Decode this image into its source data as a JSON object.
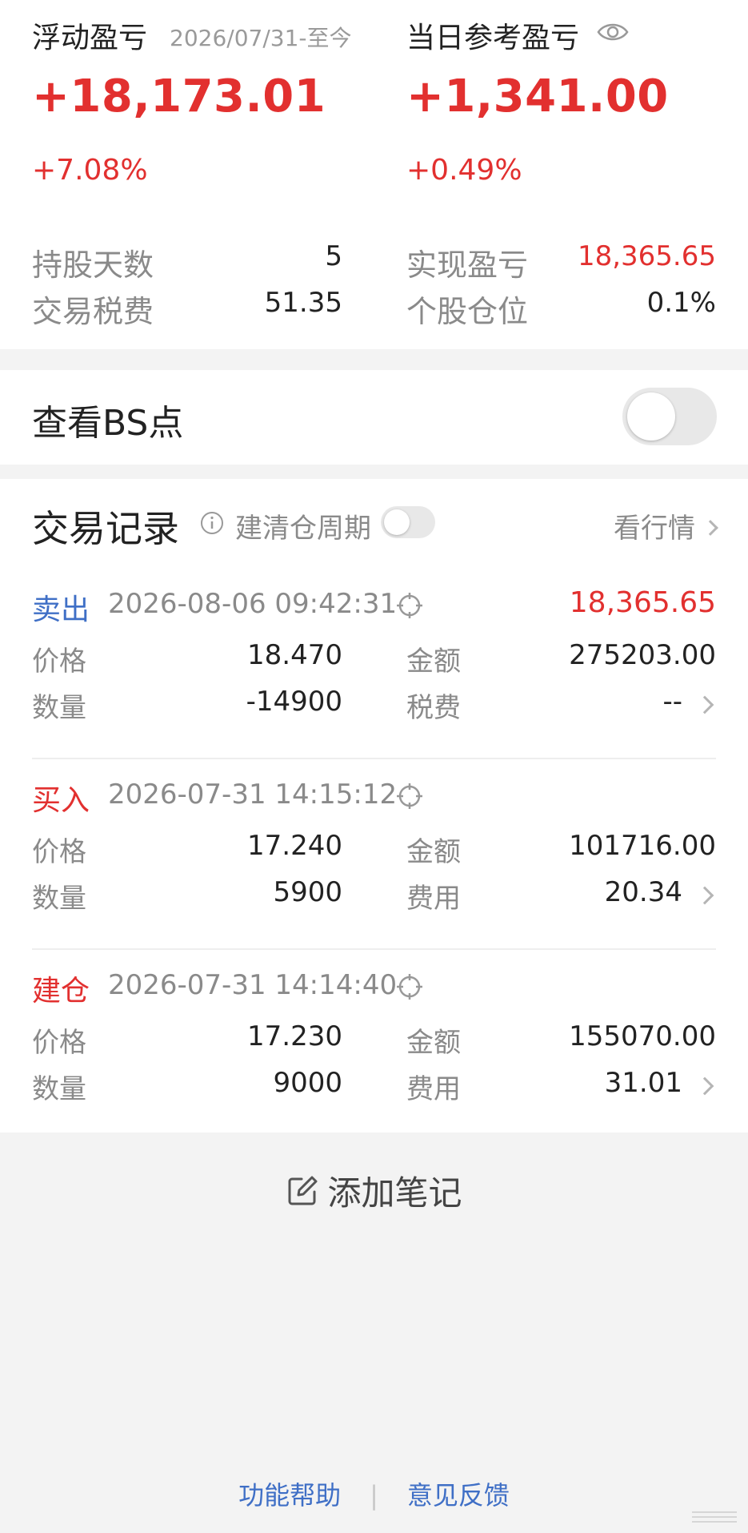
{
  "summary": {
    "floating_pl_title": "浮动盈亏",
    "date_range": "2026/07/31-至今",
    "floating_pl_value": "+18,173.01",
    "floating_pl_pct": "+7.08%",
    "daily_ref_title": "当日参考盈亏",
    "daily_ref_value": "+1,341.00",
    "daily_ref_pct": "+0.49%",
    "stats": [
      {
        "label": "持股天数",
        "value": "5"
      },
      {
        "label": "交易税费",
        "value": "51.35"
      },
      {
        "label": "实现盈亏",
        "value": "18,365.65"
      },
      {
        "label": "个股仓位",
        "value": "0.1%"
      }
    ]
  },
  "bs_toggle": {
    "label": "查看BS点",
    "on": false
  },
  "trades_section": {
    "title": "交易记录",
    "cycle_label": "建清仓周期",
    "market_link": "看行情",
    "records": [
      {
        "type": "卖出",
        "type_color": "#3f6fc6",
        "time": "2026-08-06 09:42:31",
        "profit": "18,365.65",
        "price_label": "价格",
        "price": "18.470",
        "amount_label": "金额",
        "amount": "275203.00",
        "qty_label": "数量",
        "qty": "-14900",
        "fee_label": "税费",
        "fee": "--"
      },
      {
        "type": "买入",
        "type_color": "#e2302f",
        "time": "2026-07-31 14:15:12",
        "profit": "",
        "price_label": "价格",
        "price": "17.240",
        "amount_label": "金额",
        "amount": "101716.00",
        "qty_label": "数量",
        "qty": "5900",
        "fee_label": "费用",
        "fee": "20.34"
      },
      {
        "type": "建仓",
        "type_color": "#e2302f",
        "time": "2026-07-31 14:14:40",
        "profit": "",
        "price_label": "价格",
        "price": "17.230",
        "amount_label": "金额",
        "amount": "155070.00",
        "qty_label": "数量",
        "qty": "9000",
        "fee_label": "费用",
        "fee": "31.01"
      }
    ]
  },
  "add_note": {
    "label": "添加笔记",
    "icon": "edit-icon"
  },
  "footer": {
    "help": "功能帮助",
    "separator": "|",
    "feedback": "意见反馈"
  },
  "colors": {
    "profit_red": "#e2302f",
    "sell_blue": "#3f6fc6",
    "link_blue": "#3f6fc6"
  }
}
